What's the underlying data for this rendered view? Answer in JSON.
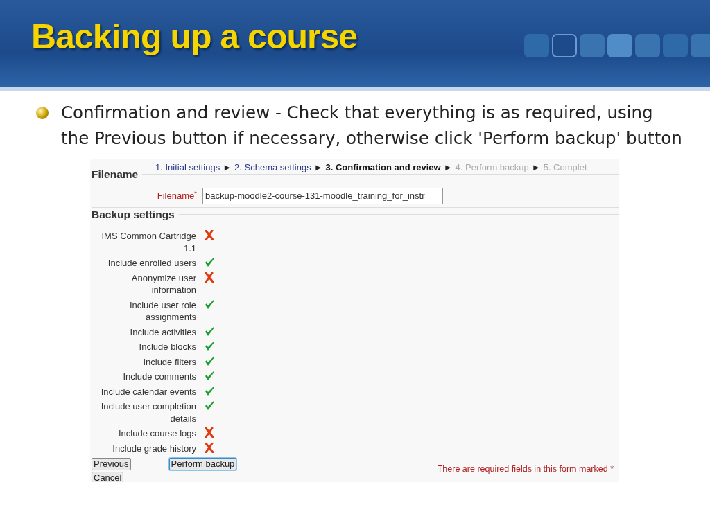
{
  "slide": {
    "title": "Backing up a course",
    "bullets": [
      "Confirmation and review - Check that everything is as required, using the Previous button if necessary, otherwise click 'Perform backup' button"
    ]
  },
  "steps": [
    {
      "label": "1. Initial settings",
      "completed": true,
      "selected": false,
      "separator": "►"
    },
    {
      "label": "2. Schema settings",
      "completed": true,
      "selected": false,
      "separator": "►"
    },
    {
      "label": "3. Confirmation and review",
      "completed": false,
      "selected": true,
      "separator": "►"
    },
    {
      "label": "4. Perform backup",
      "completed": false,
      "selected": false,
      "separator": "►"
    },
    {
      "label": "5. Complet",
      "completed": false,
      "selected": false
    }
  ],
  "filename_section": {
    "heading": "Filename",
    "label": "Filename",
    "required_mark": "*",
    "value": "backup-moodle2-course-131-moodle_training_for_instr"
  },
  "settings_section": {
    "heading": "Backup settings",
    "settings": [
      {
        "label": "IMS Common Cartridge 1.1",
        "enabled": false
      },
      {
        "label": "Include enrolled users",
        "enabled": true
      },
      {
        "label": "Anonymize user information",
        "enabled": false
      },
      {
        "label": "Include user role assignments",
        "enabled": true
      },
      {
        "label": "Include activities",
        "enabled": true
      },
      {
        "label": "Include blocks",
        "enabled": true
      },
      {
        "label": "Include filters",
        "enabled": true
      },
      {
        "label": "Include comments",
        "enabled": true
      },
      {
        "label": "Include calendar events",
        "enabled": true
      },
      {
        "label": "Include user completion details",
        "enabled": true
      },
      {
        "label": "Include course logs",
        "enabled": false
      },
      {
        "label": "Include grade history",
        "enabled": false
      }
    ]
  },
  "buttons": {
    "previous": "Previous",
    "perform": "Perform backup",
    "cancel": "Cancel"
  },
  "required_note": "There are required fields in this form marked *"
}
